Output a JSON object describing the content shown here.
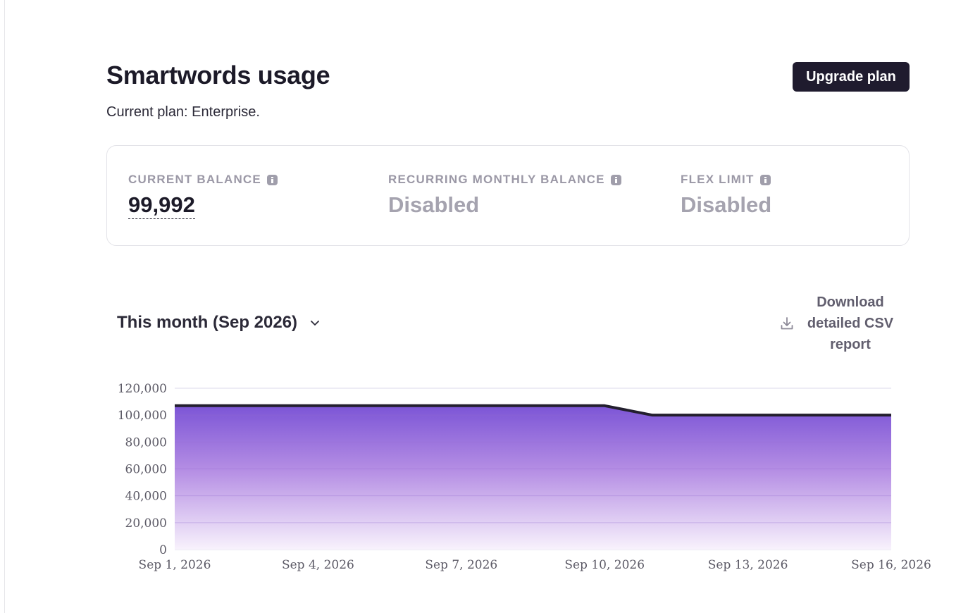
{
  "header": {
    "title": "Smartwords usage",
    "plan_text": "Current plan: Enterprise.",
    "upgrade_label": "Upgrade plan"
  },
  "stats": {
    "current_balance": {
      "label": "CURRENT BALANCE",
      "value": "99,992"
    },
    "recurring_monthly": {
      "label": "RECURRING MONTHLY BALANCE",
      "value": "Disabled"
    },
    "flex_limit": {
      "label": "FLEX LIMIT",
      "value": "Disabled"
    }
  },
  "period": {
    "selected": "This month (Sep 2026)"
  },
  "download": {
    "label": "Download detailed CSV report"
  },
  "colors": {
    "primary_dark": "#1f1b2e",
    "area_top": "#7c55d6",
    "muted_text": "#a5a3af"
  },
  "chart_data": {
    "type": "area",
    "x": [
      "Sep 1, 2026",
      "Sep 2, 2026",
      "Sep 3, 2026",
      "Sep 4, 2026",
      "Sep 5, 2026",
      "Sep 6, 2026",
      "Sep 7, 2026",
      "Sep 8, 2026",
      "Sep 9, 2026",
      "Sep 10, 2026",
      "Sep 11, 2026",
      "Sep 12, 2026",
      "Sep 13, 2026",
      "Sep 14, 2026",
      "Sep 15, 2026",
      "Sep 16, 2026"
    ],
    "series": [
      {
        "values": [
          107000,
          107000,
          107000,
          107000,
          107000,
          107000,
          107000,
          107000,
          107000,
          107000,
          100000,
          100000,
          100000,
          100000,
          99992,
          99992
        ]
      }
    ],
    "x_tick_labels": [
      "Sep 1, 2026",
      "Sep 4, 2026",
      "Sep 7, 2026",
      "Sep 10, 2026",
      "Sep 13, 2026",
      "Sep 16, 2026"
    ],
    "y_tick_labels": [
      "0",
      "20,000",
      "40,000",
      "60,000",
      "80,000",
      "100,000",
      "120,000"
    ],
    "y_ticks": [
      0,
      20000,
      40000,
      60000,
      80000,
      100000,
      120000
    ],
    "ylim": [
      0,
      120000
    ],
    "grid": true,
    "legend": "none"
  }
}
